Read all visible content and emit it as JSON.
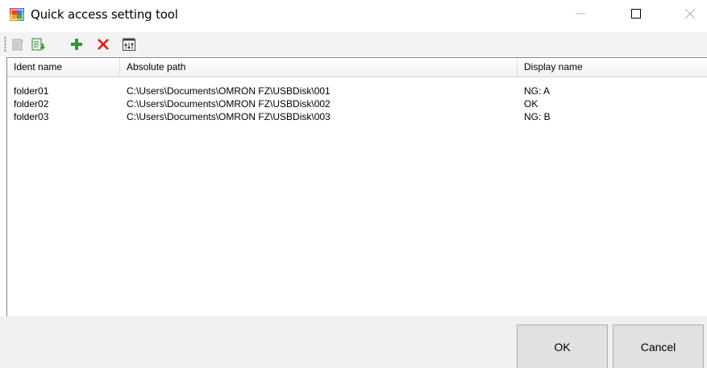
{
  "window": {
    "title": "Quick access setting tool",
    "icons": {
      "app": "app-window-icon",
      "minimize": "minimize-icon",
      "maximize": "maximize-icon",
      "close": "close-icon"
    }
  },
  "toolbar": {
    "buttons": [
      {
        "name": "export-icon",
        "enabled": false
      },
      {
        "name": "import-icon",
        "enabled": true
      },
      {
        "name": "add-icon",
        "enabled": true
      },
      {
        "name": "delete-icon",
        "enabled": true
      },
      {
        "name": "settings-icon",
        "enabled": true
      }
    ]
  },
  "list": {
    "columns": [
      "Ident name",
      "Absolute path",
      "Display name"
    ],
    "rows": [
      {
        "ident": "folder01",
        "path": "C:\\Users\\Documents\\OMRON FZ\\USBDisk\\001",
        "display": "NG: A"
      },
      {
        "ident": "folder02",
        "path": "C:\\Users\\Documents\\OMRON FZ\\USBDisk\\002",
        "display": "OK"
      },
      {
        "ident": "folder03",
        "path": "C:\\Users\\Documents\\OMRON FZ\\USBDisk\\003",
        "display": "NG: B"
      }
    ]
  },
  "buttons": {
    "ok": "OK",
    "cancel": "Cancel"
  },
  "colors": {
    "add": "#2e9a2e",
    "delete": "#e81818",
    "panel": "#f0f0f0"
  }
}
